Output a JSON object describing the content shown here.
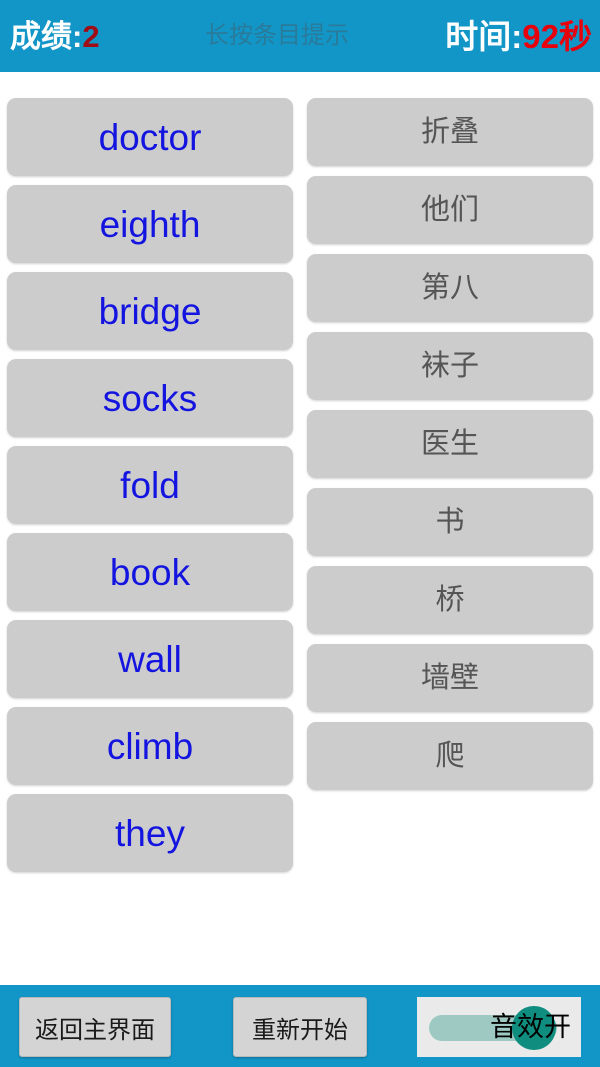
{
  "header": {
    "score_label": "成绩:",
    "score_value": "2",
    "hint": "长按条目提示",
    "time_label": "时间:",
    "time_value": "92秒",
    "bar_color": "#1296c8",
    "score_value_color": "#a00d14",
    "time_value_color": "#e8000b",
    "hint_color": "#2a7a9a"
  },
  "board": {
    "english_items": [
      {
        "label": "doctor"
      },
      {
        "label": "eighth"
      },
      {
        "label": "bridge"
      },
      {
        "label": "socks"
      },
      {
        "label": "fold"
      },
      {
        "label": "book"
      },
      {
        "label": "wall"
      },
      {
        "label": "climb"
      },
      {
        "label": "they"
      }
    ],
    "chinese_items": [
      {
        "label": "折叠"
      },
      {
        "label": "他们"
      },
      {
        "label": "第八"
      },
      {
        "label": "袜子"
      },
      {
        "label": "医生"
      },
      {
        "label": "书"
      },
      {
        "label": "桥"
      },
      {
        "label": "墙壁"
      },
      {
        "label": "爬"
      }
    ],
    "card_color": "#cccccc",
    "english_text_color": "#1414e0",
    "chinese_text_color": "#555555"
  },
  "footer": {
    "home_label": "返回主界面",
    "restart_label": "重新开始",
    "sound_label": "音效开",
    "sound_state": "on",
    "switch_track_color": "#9ec9c2",
    "switch_thumb_color": "#0f8d7e"
  }
}
